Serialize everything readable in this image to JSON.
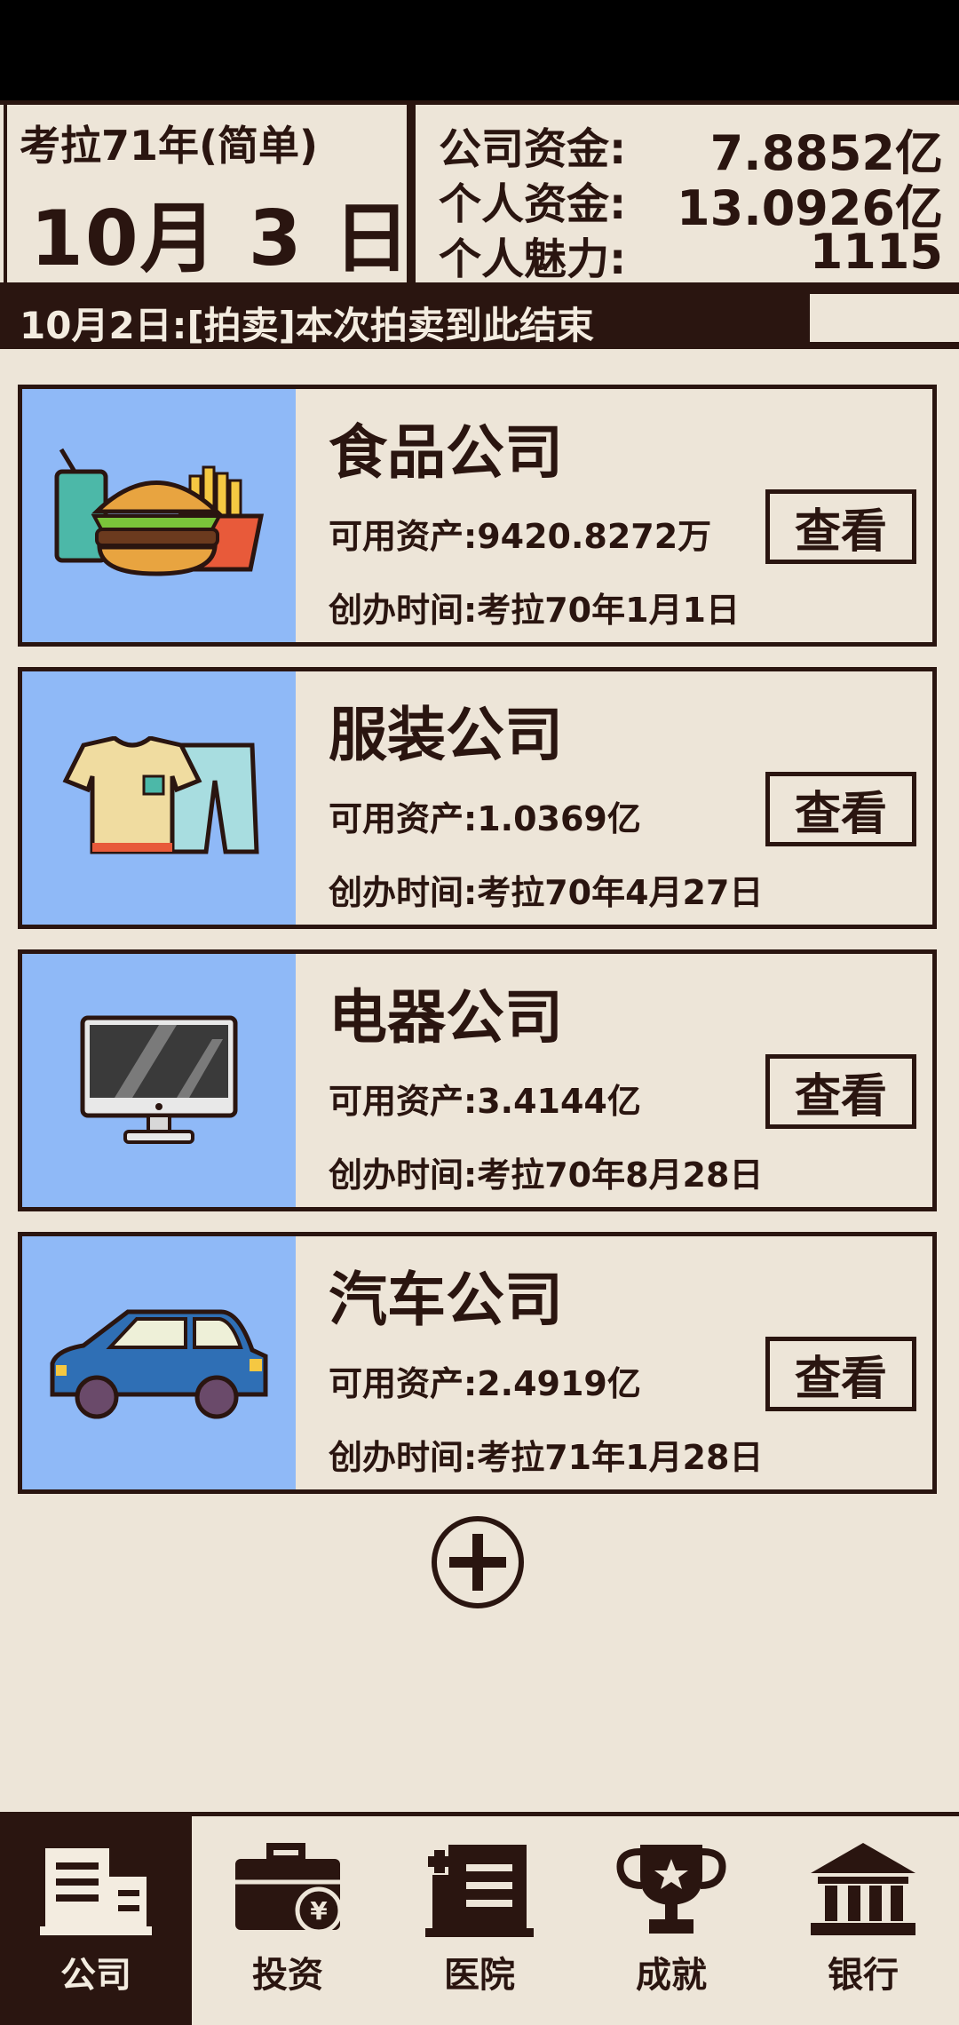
{
  "header": {
    "year_label": "考拉71年(简单)",
    "month": "10月",
    "day": "3",
    "day_unit": "日",
    "company_funds_label": "公司资金:",
    "company_funds_value": "7.8852亿",
    "personal_funds_label": "个人资金:",
    "personal_funds_value": "13.0926亿",
    "charm_label": "个人魅力:",
    "charm_value": "1115"
  },
  "ticker": {
    "text": "10月2日:[拍卖]本次拍卖到此结束"
  },
  "companies": [
    {
      "name": "食品公司",
      "assets": "可用资产:9420.8272万",
      "founded": "创办时间:考拉70年1月1日",
      "view_label": "查看",
      "icon": "food-burger-fries-icon"
    },
    {
      "name": "服装公司",
      "assets": "可用资产:1.0369亿",
      "founded": "创办时间:考拉70年4月27日",
      "view_label": "查看",
      "icon": "clothing-shirt-pants-icon"
    },
    {
      "name": "电器公司",
      "assets": "可用资产:3.4144亿",
      "founded": "创办时间:考拉70年8月28日",
      "view_label": "查看",
      "icon": "monitor-icon"
    },
    {
      "name": "汽车公司",
      "assets": "可用资产:2.4919亿",
      "founded": "创办时间:考拉71年1月28日",
      "view_label": "查看",
      "icon": "car-icon"
    }
  ],
  "add_button_icon": "plus-circle-icon",
  "nav": [
    {
      "label": "公司",
      "icon": "company-building-icon",
      "active": true
    },
    {
      "label": "投资",
      "icon": "briefcase-yen-icon",
      "active": false
    },
    {
      "label": "医院",
      "icon": "hospital-icon",
      "active": false
    },
    {
      "label": "成就",
      "icon": "trophy-icon",
      "active": false
    },
    {
      "label": "银行",
      "icon": "bank-icon",
      "active": false
    }
  ],
  "colors": {
    "background": "#ede5d8",
    "ink": "#2a1510",
    "card_image_bg": "#8fb9f7"
  }
}
